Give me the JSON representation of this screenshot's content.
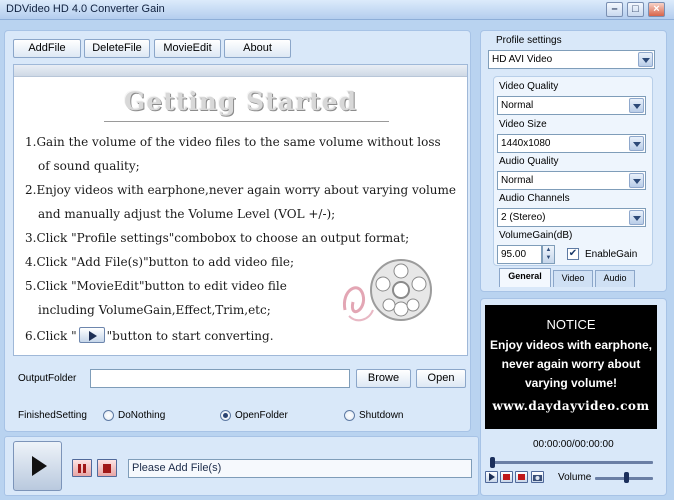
{
  "window": {
    "title": "DDVideo HD 4.0 Converter Gain"
  },
  "toolbar": {
    "add_file": "AddFile",
    "delete_file": "DeleteFile",
    "movie_edit": "MovieEdit",
    "about": "About"
  },
  "guide": {
    "title": "Getting Started",
    "lines": [
      "1.Gain the volume of the video files to the same volume without loss",
      "of sound quality;",
      "2.Enjoy videos with earphone,never again worry about varying volume",
      "and manually adjust the Volume Level (VOL +/-);",
      "3.Click \"Profile settings\"combobox to choose an output format;",
      "4.Click \"Add File(s)\"button to add video file;",
      "5.Click \"MovieEdit\"button to edit video file",
      "including VolumeGain,Effect,Trim,etc;",
      "6.Click \"",
      "\"button to start converting."
    ]
  },
  "output": {
    "label": "OutputFolder",
    "value": "",
    "browse": "Browe",
    "open": "Open"
  },
  "finished": {
    "label": "FinishedSetting",
    "options": [
      "DoNothing",
      "OpenFolder",
      "Shutdown"
    ],
    "selected": "OpenFolder"
  },
  "status": {
    "text": "Please Add File(s)"
  },
  "profile": {
    "label": "Profile settings",
    "value": "HD AVI Video",
    "video_quality_label": "Video Quality",
    "video_quality": "Normal",
    "video_size_label": "Video Size",
    "video_size": "1440x1080",
    "audio_quality_label": "Audio Quality",
    "audio_quality": "Normal",
    "audio_channels_label": "Audio Channels",
    "audio_channels": "2 (Stereo)",
    "volume_gain_label": "VolumeGain(dB)",
    "volume_gain": "95.00",
    "enable_gain_label": "EnableGain",
    "enable_gain_checked": true
  },
  "tabs": [
    "General",
    "Video",
    "Audio"
  ],
  "active_tab": "General",
  "notice": {
    "title": "NOTICE",
    "lines": [
      "Enjoy videos with earphone,",
      "never again worry about",
      "varying volume!"
    ],
    "url": "www.daydayvideo.com"
  },
  "player": {
    "time": "00:00:00/00:00:00",
    "volume_label": "Volume",
    "volume_level": 0.55
  },
  "icons": {
    "play": "play-icon",
    "pause": "pause-icon",
    "stop": "stop-icon",
    "film_reel": "film-reel-icon"
  }
}
